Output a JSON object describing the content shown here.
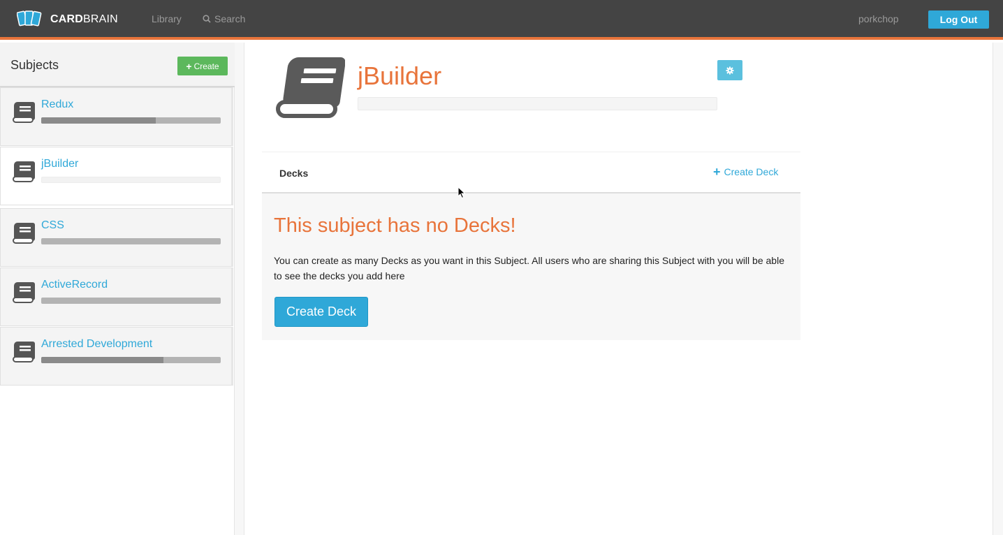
{
  "header": {
    "brand_bold": "CARD",
    "brand_light": "BRAIN",
    "nav": {
      "library": "Library",
      "search": "Search"
    },
    "username": "porkchop",
    "logout_label": "Log Out"
  },
  "sidebar": {
    "title": "Subjects",
    "create_label": "Create",
    "items": [
      {
        "label": "Redux",
        "progress": 0.64
      },
      {
        "label": "jBuilder",
        "progress": 0.0
      },
      {
        "label": "CSS",
        "progress": 0.0
      },
      {
        "label": "ActiveRecord",
        "progress": 0.0
      },
      {
        "label": "Arrested Development",
        "progress": 0.68
      }
    ],
    "active_index": 1
  },
  "main": {
    "subject_title": "jBuilder",
    "decks_label": "Decks",
    "create_deck_link": "Create Deck",
    "empty_title": "This subject has no Decks!",
    "empty_text": "You can create as many Decks as you want in this Subject. All users who are sharing this Subject with you will be able to see the decks you add here",
    "create_deck_button": "Create Deck"
  },
  "colors": {
    "accent_orange": "#e8743b",
    "link_blue": "#2fa8d8",
    "create_green": "#5cb85c",
    "topbar": "#444444"
  }
}
